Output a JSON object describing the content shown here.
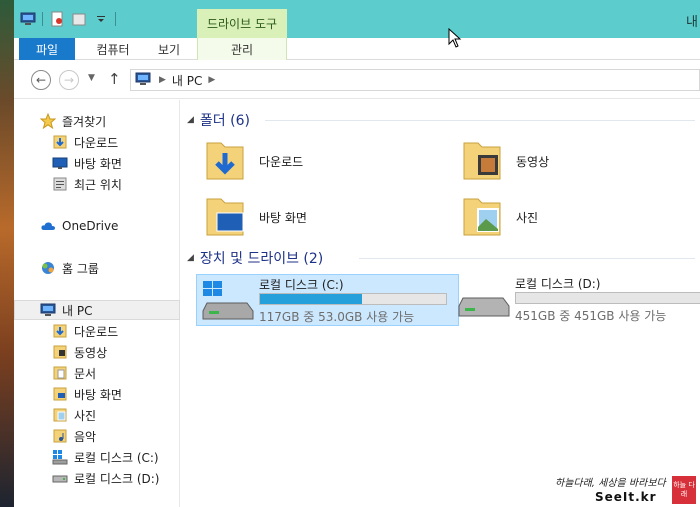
{
  "titlebar": {
    "context_tab_label": "드라이브 도구",
    "title_text": "내"
  },
  "ribbon": {
    "tabs": [
      "파일",
      "컴퓨터",
      "보기",
      "관리"
    ]
  },
  "address_bar": {
    "crumbs": [
      "내 PC"
    ]
  },
  "nav_pane": {
    "favorites": "즐겨찾기",
    "favorites_items": [
      "다운로드",
      "바탕 화면",
      "최근 위치"
    ],
    "onedrive": "OneDrive",
    "homegroup": "홈 그룹",
    "this_pc": "내 PC",
    "this_pc_items": [
      "다운로드",
      "동영상",
      "문서",
      "바탕 화면",
      "사진",
      "음악",
      "로컬 디스크 (C:)",
      "로컬 디스크 (D:)"
    ]
  },
  "content": {
    "folders_header": "폴더 (6)",
    "folders": [
      "다운로드",
      "동영상",
      "바탕 화면",
      "사진"
    ],
    "drives_header": "장치 및 드라이브 (2)",
    "drives": [
      {
        "name": "로컬 디스크 (C:)",
        "space": "117GB 중 53.0GB 사용 가능",
        "used_fraction": 0.55
      },
      {
        "name": "로컬 디스크 (D:)",
        "space": "451GB 중 451GB 사용 가능",
        "used_fraction": 0.0
      }
    ]
  },
  "watermark": {
    "line1": "하늘다래, 세상을 바라보다",
    "line2": "SeeIt.kr",
    "badge": "하늘 다래"
  },
  "colors": {
    "titlebar": "#5ccccc",
    "file_tab": "#1979ca",
    "context_tab": "#d9f0b8",
    "selection": "#cce8ff",
    "drive_bar_fill": "#26a0da",
    "group_header": "#1e3287"
  }
}
